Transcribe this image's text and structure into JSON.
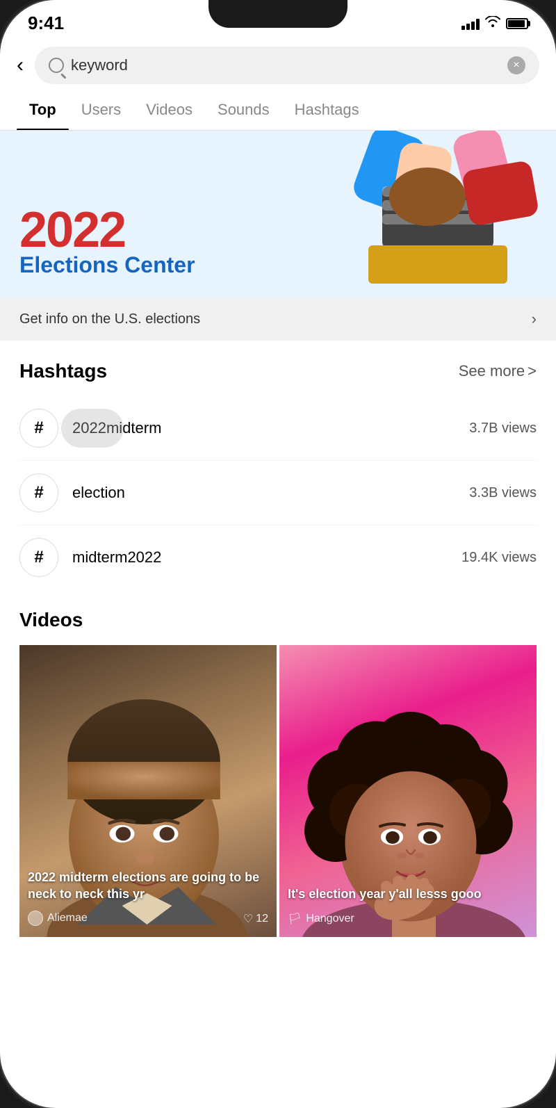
{
  "status_bar": {
    "time": "9:41",
    "signal": "signal",
    "wifi": "wifi",
    "battery": "battery"
  },
  "search": {
    "query": "keyword",
    "clear_icon": "×",
    "back_icon": "<"
  },
  "tabs": [
    {
      "id": "top",
      "label": "Top",
      "active": true
    },
    {
      "id": "users",
      "label": "Users",
      "active": false
    },
    {
      "id": "videos",
      "label": "Videos",
      "active": false
    },
    {
      "id": "sounds",
      "label": "Sounds",
      "active": false
    },
    {
      "id": "hashtags",
      "label": "Hashtags",
      "active": false
    }
  ],
  "banner": {
    "year": "2022",
    "title": "Elections Center",
    "footer_text": "Get info on the U.S. elections",
    "chevron": "›"
  },
  "hashtags_section": {
    "title": "Hashtags",
    "see_more_label": "See more",
    "see_more_chevron": ">",
    "items": [
      {
        "id": 1,
        "tag": "2022midterm",
        "views": "3.7B views",
        "highlighted": true
      },
      {
        "id": 2,
        "tag": "election",
        "views": "3.3B views",
        "highlighted": false
      },
      {
        "id": 3,
        "tag": "midterm2022",
        "views": "19.4K views",
        "highlighted": false
      }
    ],
    "hash_symbol": "#"
  },
  "videos_section": {
    "title": "Videos",
    "items": [
      {
        "id": 1,
        "caption": "2022 midterm elections are going to be neck to neck this yr",
        "author": "Aliemae",
        "likes": "12",
        "bg_color_start": "#5a4030",
        "bg_color_end": "#9b7055"
      },
      {
        "id": 2,
        "caption": "It's election year y'all lesss gooo",
        "author": "Hangover",
        "likes": "",
        "bg_color_start": "#f48fb1",
        "bg_color_end": "#e91e8c",
        "flag": "🏳️"
      }
    ]
  }
}
